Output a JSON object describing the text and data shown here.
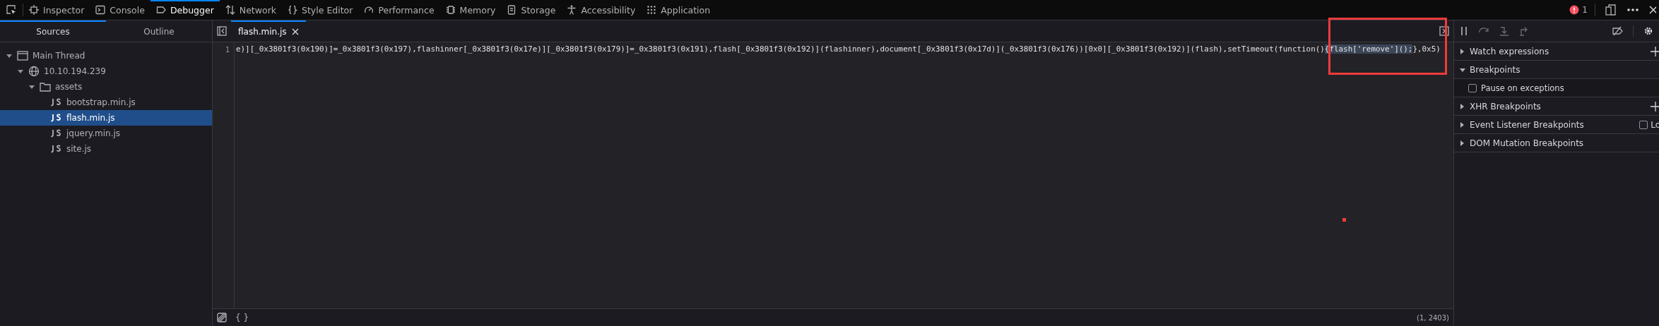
{
  "toolbar": {
    "tabs": [
      {
        "label": "Inspector",
        "selected": false
      },
      {
        "label": "Console",
        "selected": false
      },
      {
        "label": "Debugger",
        "selected": true
      },
      {
        "label": "Network",
        "selected": false
      },
      {
        "label": "Style Editor",
        "selected": false
      },
      {
        "label": "Performance",
        "selected": false
      },
      {
        "label": "Memory",
        "selected": false
      },
      {
        "label": "Storage",
        "selected": false
      },
      {
        "label": "Accessibility",
        "selected": false
      },
      {
        "label": "Application",
        "selected": false
      }
    ],
    "error_count": "1"
  },
  "sources_panel": {
    "tabs": [
      {
        "label": "Sources",
        "selected": true
      },
      {
        "label": "Outline",
        "selected": false
      }
    ],
    "tree": [
      {
        "label": "Main Thread",
        "kind": "thread",
        "expanded": true,
        "selected": false,
        "children": [
          {
            "label": "10.10.194.239",
            "kind": "host",
            "expanded": true,
            "selected": false,
            "children": [
              {
                "label": "assets",
                "kind": "folder",
                "expanded": true,
                "selected": false,
                "children": [
                  {
                    "label": "bootstrap.min.js",
                    "kind": "file",
                    "selected": false
                  },
                  {
                    "label": "flash.min.js",
                    "kind": "file",
                    "selected": true
                  },
                  {
                    "label": "jquery.min.js",
                    "kind": "file",
                    "selected": false
                  },
                  {
                    "label": "site.js",
                    "kind": "file",
                    "selected": false
                  }
                ]
              }
            ]
          }
        ]
      }
    ]
  },
  "editor": {
    "tabs": [
      {
        "label": "flash.min.js",
        "selected": true
      }
    ],
    "lines": [
      {
        "number": "1",
        "segments": [
          {
            "text": "e)][_0x3801f3(0x190)]=_0x3801f3(0x197),flashinner[_0x3801f3(0x17e)][_0x3801f3(0x179)]=_0x3801f3(0x191),flash[_0x3801f3(0x192)](flashinner),document[_0x3801f3(0x17d)](_0x3801f3(0x176))[0x0][_0x3801f3(0x192)](flash),setTimeout(function()",
            "highlighted": false
          },
          {
            "text": "{flash['remove']();",
            "highlighted": true
          },
          {
            "text": "},0x5)",
            "highlighted": false
          }
        ]
      }
    ],
    "cursor_position": "(1, 2403)",
    "pretty_print": "{ }"
  },
  "side_panel": {
    "sections": [
      {
        "title": "Watch expressions",
        "expanded": false,
        "kind": "add"
      },
      {
        "title": "Breakpoints",
        "expanded": true,
        "kind": "plain",
        "items": [
          {
            "label": "Pause on exceptions",
            "checked": false
          }
        ]
      },
      {
        "title": "XHR Breakpoints",
        "expanded": false,
        "kind": "add"
      },
      {
        "title": "Event Listener Breakpoints",
        "expanded": false,
        "kind": "checkbox",
        "checkbox_label": "Lo",
        "checked": false
      },
      {
        "title": "DOM Mutation Breakpoints",
        "expanded": false,
        "kind": "plain"
      }
    ]
  },
  "annotations": {
    "highlight_box": {
      "color": "#ee3b3b"
    },
    "marker_dot": {
      "color": "#ee3b3b"
    }
  }
}
